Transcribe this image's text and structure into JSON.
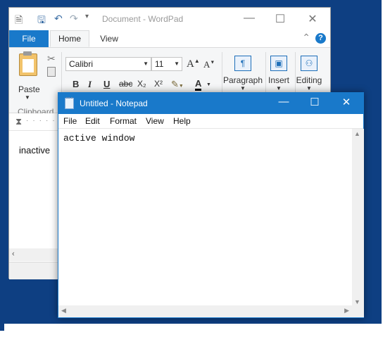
{
  "wordpad": {
    "title": "Document - WordPad",
    "tabs": [
      "File",
      "Home",
      "View"
    ],
    "help_glyph": "?",
    "font_name": "Calibri",
    "font_size": "11",
    "paste_label": "Paste",
    "clipboard_label": "Clipboard",
    "groups": [
      "Paragraph",
      "Insert",
      "Editing"
    ],
    "format_buttons": [
      "B",
      "I",
      "U",
      "abc",
      "X₂",
      "X²"
    ],
    "body_text": "inactive"
  },
  "notepad": {
    "title": "Untitled - Notepad",
    "menu": [
      "File",
      "Edit",
      "Format",
      "View",
      "Help"
    ],
    "content": "active window"
  },
  "colors": {
    "desktop": "#0e3f82",
    "accent": "#1979ca"
  }
}
